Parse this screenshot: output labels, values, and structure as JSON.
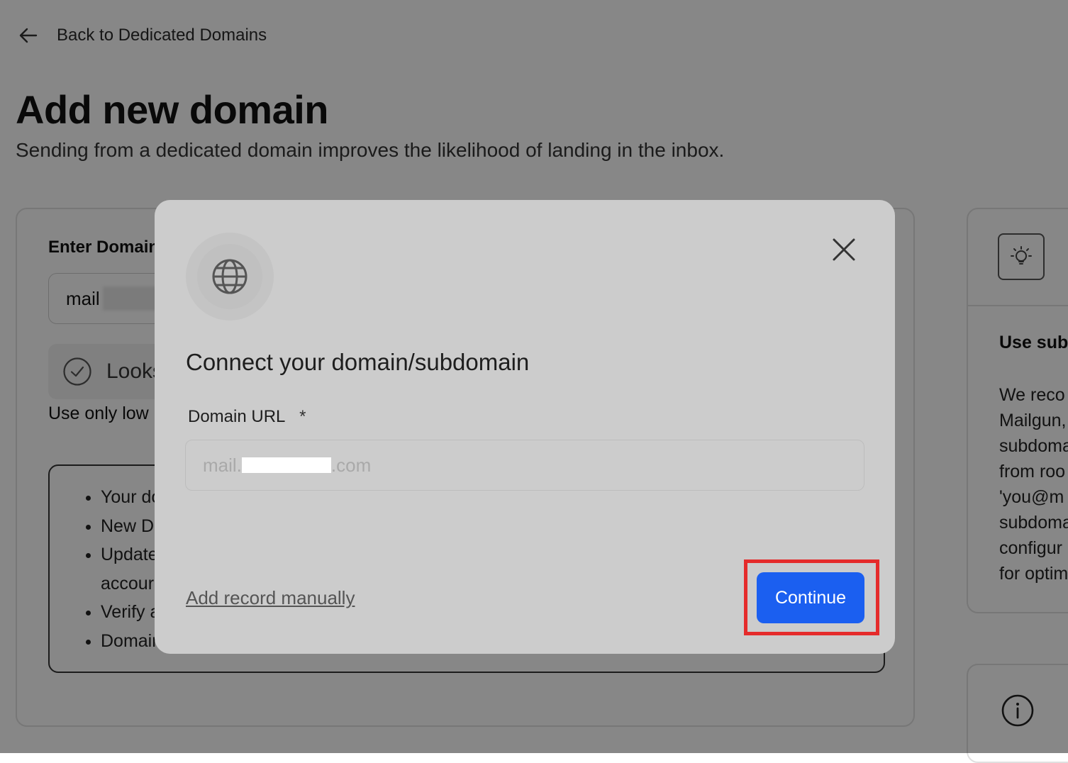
{
  "header": {
    "back_label": "Back to Dedicated Domains",
    "title": "Add new domain",
    "subtitle": "Sending from a dedicated domain improves the likelihood of landing in the inbox."
  },
  "form": {
    "enter_label": "Enter Domain",
    "domain_value": "mail",
    "check_text": "Looks",
    "lowercase_hint": "Use only low",
    "checklist": [
      "Your do",
      "New D",
      "Update",
      "accour",
      "Verify a",
      "Domain"
    ]
  },
  "tip": {
    "title": "Use sub",
    "body": "We reco\nMailgun,\nsubdoma\nfrom roo\n'you@m\nsubdoma\nconfigur\nfor optim"
  },
  "modal": {
    "title": "Connect your domain/subdomain",
    "field_label": "Domain URL",
    "required_mark": "*",
    "placeholder_prefix": "mail.",
    "placeholder_suffix": ".com",
    "manual_link": "Add record manually",
    "continue_label": "Continue"
  },
  "icons": {
    "back": "arrow-left-icon",
    "globe": "globe-icon",
    "close": "close-icon",
    "check": "check-circle-icon",
    "bulb": "lightbulb-icon",
    "info": "info-icon"
  },
  "colors": {
    "primary": "#1b5ff0",
    "highlight": "#e52b2b",
    "overlay": "rgba(0,0,0,0.47)"
  }
}
